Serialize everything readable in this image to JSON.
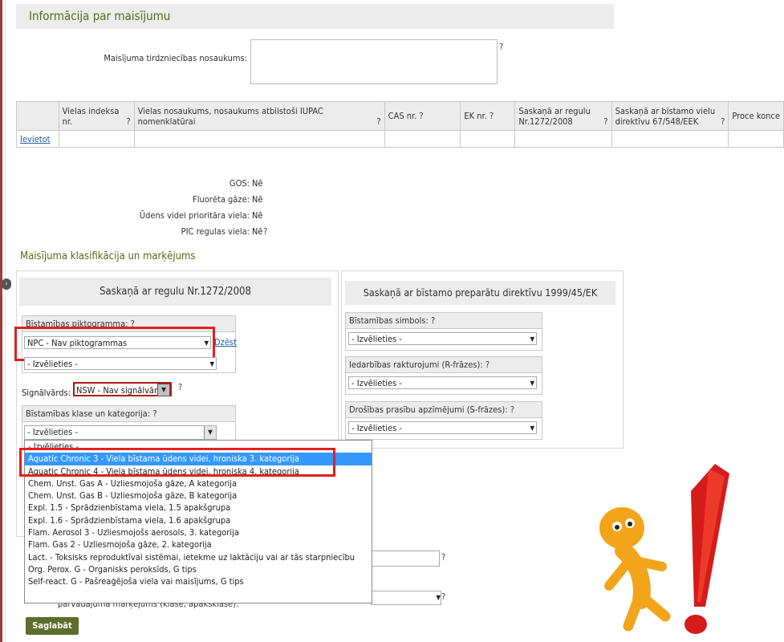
{
  "section_title": "Informācija par maisījumu",
  "trade_name_label": "Maisījuma tirdzniecības nosaukums:",
  "help_mark": "?",
  "table": {
    "headers": [
      "",
      "Vielas indeksa nr.",
      "Vielas nosaukums, nosaukums atbilstoši IUPAC nomenklatūrai",
      "CAS nr.",
      "EK nr.",
      "Saskaņā ar regulu Nr.1272/2008",
      "Saskaņā ar bīstamo vielu direktīvu 67/548/EEK",
      "Proce konce"
    ],
    "insert_link": "Ievietot"
  },
  "props": {
    "gos_label": "GOS:",
    "gos_value": "Nē",
    "fluor_label": "Fluorēta gāze:",
    "fluor_value": "Nē",
    "water_label": "Ūdens videi prioritāra viela:",
    "water_value": "Nē",
    "pic_label": "PIC regulas viela:",
    "pic_value": "Nē"
  },
  "classification_title": "Maisījuma klasifikācija un marķējums",
  "left_panel": {
    "title": "Saskaņā ar regulu Nr.1272/2008",
    "pictogram_label": "Bīstamības piktogramma:",
    "pictogram_value": "NPC - Nav piktogrammas",
    "delete_link": "Dzēst",
    "choose_value": "- Izvēlieties -",
    "signal_label": "Signālvārds:",
    "signal_value": "NSW - Nav signālvārd",
    "class_label": "Bīstamības klase un kategorija:",
    "class_value": "- Izvēlieties -"
  },
  "right_panel": {
    "title": "Saskaņā ar bīstamo preparātu direktīvu 1999/45/EK",
    "symbol_label": "Bīstamības simbols:",
    "symbol_value": "- Izvēlieties -",
    "r_label": "Iedarbības rakturojumi (R-frāzes):",
    "r_value": "- Izvēlieties -",
    "s_label": "Drošības prasību apzīmējumi (S-frāzes):",
    "s_value": "- Izvēlieties -"
  },
  "dropdown_options": [
    "- Izvēlieties -",
    "Aquatic Chronic 3 - Viela bīstama ūdens videi, hroniska 3. kategorija",
    "Aquatic Chronic 4 - Viela bīstama ūdens videi, hroniska 4. kategorija",
    "Chem. Unst. Gas A - Uzliesmojoša gāze, A kategorija",
    "Chem. Unst. Gas B - Uzliesmojoša gāze, B kategorija",
    "Expl. 1.5 - Sprādzienbīstama viela, 1.5 apakšgrupa",
    "Expl. 1.6 - Sprādzienbīstama viela, 1.6 apakšgrupa",
    "Flam. Aerosol 3 - Uzliesmojošs aerosols, 3. kategorija",
    "Flam. Gas 2 - Uzliesmojoša gāze, 2. kategorija",
    "Lact. - Toksisks reproduktīvai sistēmai, ietekme uz laktāciju vai ar tās starpniecību",
    "Org. Perox. G - Organisks peroksīds, G tips",
    "Self-react. G - Pašreaģējoša viela vai maisījums, G tips"
  ],
  "selected_option_index": 1,
  "bottom_partial_label": "pārvadājuma marķējums (klase, apakšklase):",
  "save_button": "Saglabāt",
  "colors": {
    "accent_green": "#4f6c18",
    "highlight_red": "#e02020",
    "selection_blue": "#3399ff"
  }
}
